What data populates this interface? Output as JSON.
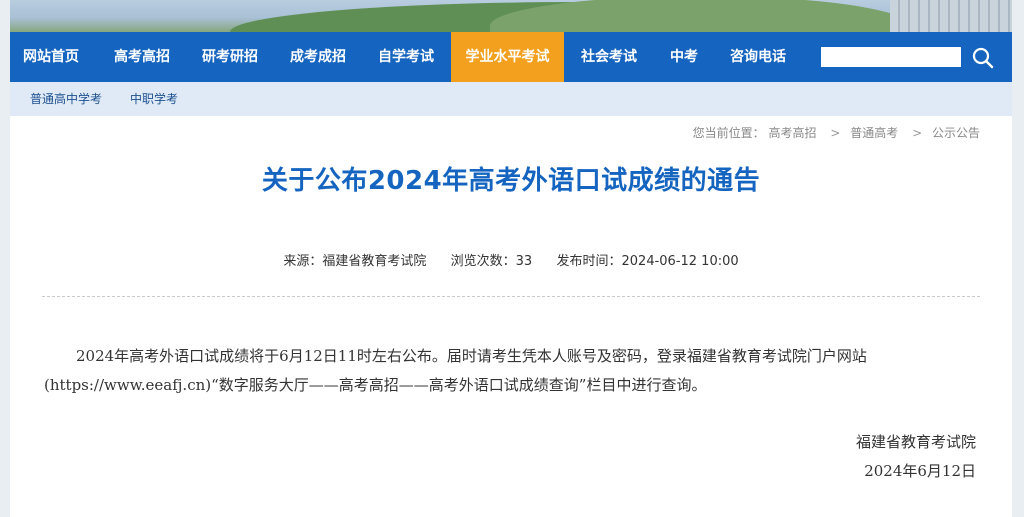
{
  "nav": {
    "items": [
      "网站首页",
      "高考高招",
      "研考研招",
      "成考成招",
      "自学考试",
      "学业水平考试",
      "社会考试",
      "中考",
      "咨询电话"
    ],
    "active_index": 5,
    "search_placeholder": ""
  },
  "subnav": {
    "items": [
      "普通高中学考",
      "中职学考"
    ]
  },
  "breadcrumb": {
    "prefix": "您当前位置：",
    "items": [
      "高考高招",
      "普通高考",
      "公示公告"
    ],
    "separator": ">"
  },
  "article": {
    "title": "关于公布2024年高考外语口试成绩的通告",
    "source_label": "来源：",
    "source": "福建省教育考试院",
    "views_label": "浏览次数：",
    "views": "33",
    "published_label": "发布时间：",
    "published": "2024-06-12 10:00",
    "body": "2024年高考外语口试成绩将于6月12日11时左右公布。届时请考生凭本人账号及密码，登录福建省教育考试院门户网站(https://www.eeafj.cn)“数字服务大厅——高考高招——高考外语口试成绩查询”栏目中进行查询。",
    "signature_org": "福建省教育考试院",
    "signature_date": "2024年6月12日"
  },
  "colors": {
    "nav_bg": "#1565c0",
    "nav_active": "#f2a01d",
    "title": "#1565c0"
  },
  "icons": {
    "search": "search-icon"
  }
}
